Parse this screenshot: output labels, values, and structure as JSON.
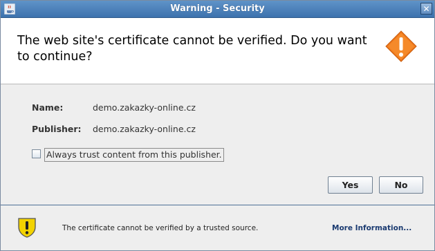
{
  "window": {
    "title": "Warning - Security",
    "close_glyph": "✕",
    "app_icon": "java-coffee-icon"
  },
  "header": {
    "headline": "The web site's certificate cannot be verified.  Do you want to continue?",
    "warning_icon": "warning-diamond-icon",
    "warning_color": "#f07a1c"
  },
  "details": {
    "name_label": "Name:",
    "name_value": "demo.zakazky-online.cz",
    "publisher_label": "Publisher:",
    "publisher_value": "demo.zakazky-online.cz"
  },
  "trust": {
    "checkbox_label": "Always trust content from this publisher.",
    "checked": false
  },
  "buttons": {
    "yes_label": "Yes",
    "no_label": "No"
  },
  "footer": {
    "message": "The certificate cannot be verified by a trusted source.",
    "more_info_label": "More Information...",
    "shield_icon": "warning-shield-icon",
    "shield_color": "#f3d300"
  }
}
